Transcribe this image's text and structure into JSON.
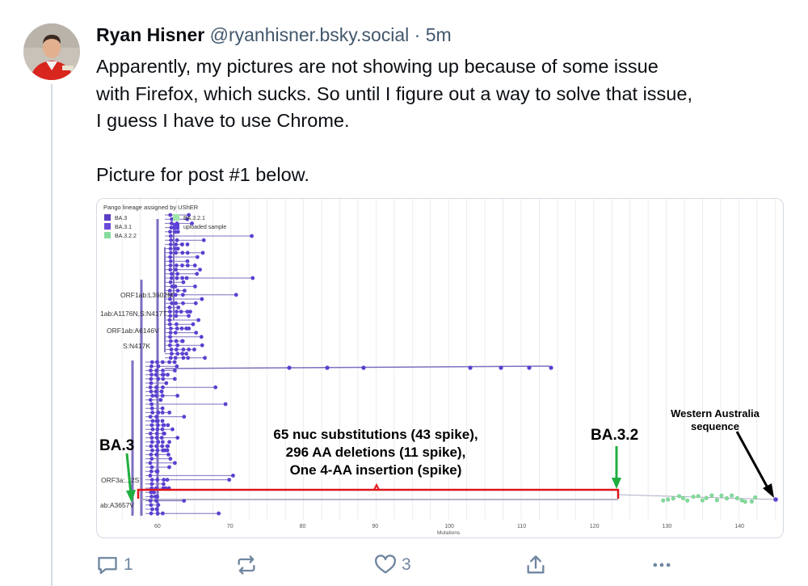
{
  "post": {
    "author_name": "Ryan Hisner",
    "handle": "@ryanhisner.bsky.social",
    "separator": "·",
    "time": "5m",
    "paragraphs": [
      "Apparently, my pictures are not showing up because of some issue",
      "with Firefox, which sucks. So until I figure out a way to solve that issue,",
      "I guess I have to use Chrome."
    ],
    "caption": "Picture for post #1 below."
  },
  "image": {
    "legend_title": "Pango lineage assigned by UShER",
    "legend": [
      {
        "label": "BA.3",
        "color": "#5b3fc4"
      },
      {
        "label": "BA.3.1",
        "color": "#6c4ad8"
      },
      {
        "label": "BA.3.2.2",
        "color": "#86dc9c"
      },
      {
        "label": "BA.3.2.1",
        "color": "#9ee6a9"
      },
      {
        "label": "uploaded sample",
        "color": "#5a44d9"
      }
    ],
    "node_labels": [
      "ORF1ab:L3602M",
      "1ab:A1176N,S:N417T",
      "ORF1ab:A6146V",
      "S:N417K",
      "ORF3a:...2S",
      "ab:A3657V"
    ],
    "x_ticks": [
      "60",
      "70",
      "80",
      "90",
      "100",
      "110",
      "120",
      "130",
      "140"
    ],
    "x_axis_label": "Mutations",
    "annotation_ba3": "BA.3",
    "annotation_ba32": "BA.3.2",
    "annotation_center_line1": "65 nuc substitutions (43 spike),",
    "annotation_center_line2": "296 AA deletions (11 spike),",
    "annotation_center_line3": "One 4-AA insertion (spike)",
    "annotation_wa_line1": "Western Australia",
    "annotation_wa_line2": "sequence",
    "colors": {
      "tree": "#7e6fc0",
      "dot": "#5b3fd0",
      "green_dot": "#86dc9c",
      "red_bracket": "#e0141a",
      "green_arrow": "#1fae3f",
      "black_arrow": "#000000"
    }
  },
  "actions": {
    "reply_count": "1",
    "repost_count": "",
    "like_count": "3"
  },
  "icons": [
    "avatar",
    "reply-icon",
    "repost-icon",
    "like-icon",
    "share-icon",
    "more-icon"
  ],
  "colors": {
    "text": "#0b0f14",
    "muted": "#42576c",
    "action": "#6f869f",
    "border": "#d4dbe2"
  }
}
